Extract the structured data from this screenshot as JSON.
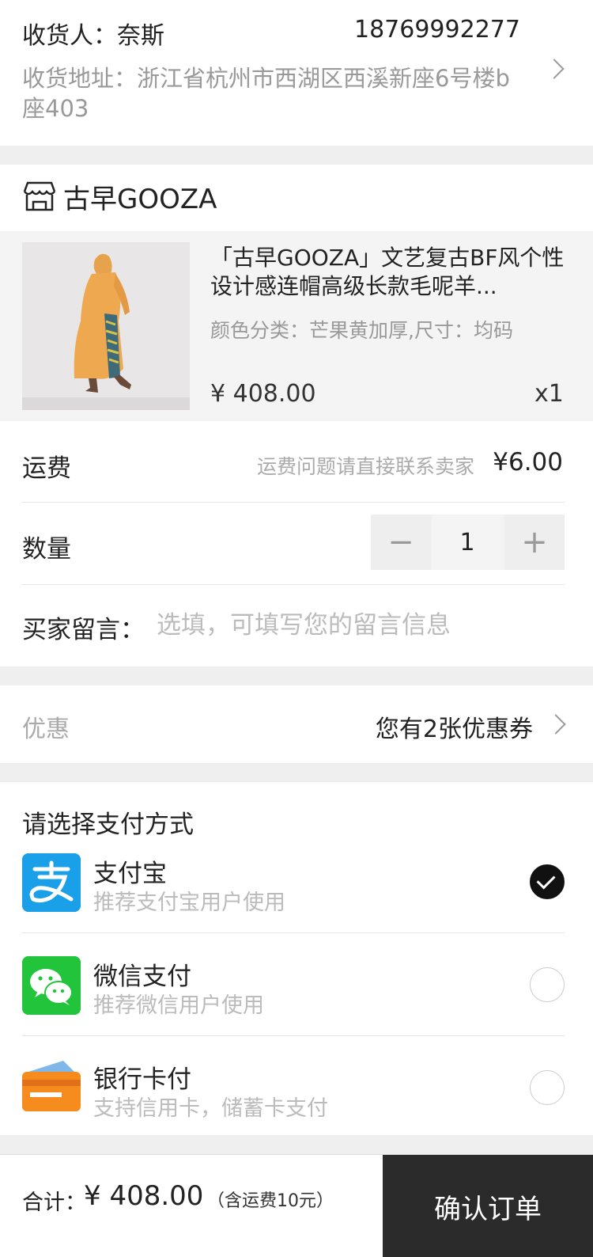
{
  "address": {
    "recipient": "收货人：奈斯",
    "phone": "18769992277",
    "detail": "收货地址：浙江省杭州市西湖区西溪新座6号楼b座403"
  },
  "store": {
    "name": "古早GOOZA"
  },
  "product": {
    "title": "「古早GOOZA」文艺复古BF风个性设计感连帽高级长款毛呢羊...",
    "spec": "颜色分类：芒果黄加厚,尺寸：均码",
    "price": "¥ 408.00",
    "quantity": "x1"
  },
  "shipping": {
    "label": "运费",
    "note": "运费问题请直接联系卖家",
    "fee": "¥6.00"
  },
  "quantity": {
    "label": "数量",
    "value": "1",
    "minus": "−",
    "plus": "+"
  },
  "message": {
    "label": "买家留言：",
    "placeholder": "选填，可填写您的留言信息"
  },
  "coupon": {
    "label": "优惠",
    "value": "您有2张优惠券"
  },
  "payment": {
    "title": "请选择支付方式",
    "methods": [
      {
        "name": "支付宝",
        "desc": "推荐支付宝用户使用",
        "icon": "alipay-icon",
        "color": "#1aa0e8",
        "selected": true
      },
      {
        "name": "微信支付",
        "desc": "推荐微信用户使用",
        "icon": "wechat-icon",
        "color": "#21c43a",
        "selected": false
      },
      {
        "name": "银行卡付",
        "desc": "支持信用卡，储蓄卡支付",
        "icon": "bank-card-icon",
        "color": "#f68b1e",
        "selected": false
      }
    ]
  },
  "footer": {
    "total_label": "合计：",
    "total_amount": "¥ 408.00",
    "total_note": "（含运费10元）",
    "confirm": "确认订单"
  }
}
